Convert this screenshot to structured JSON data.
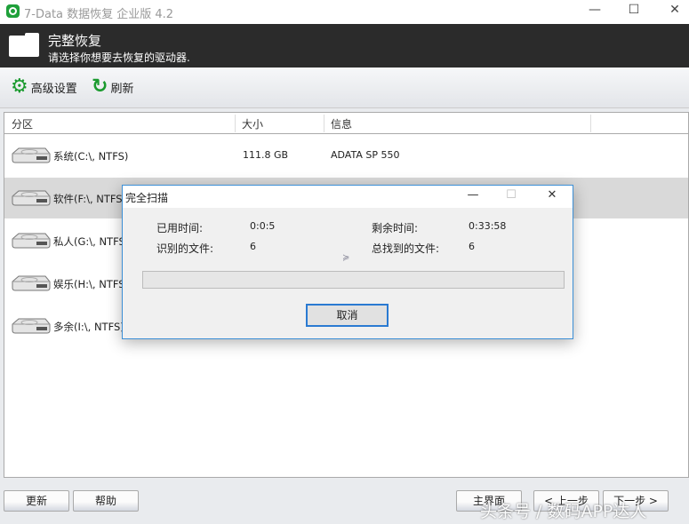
{
  "window": {
    "title": "7-Data 数据恢复 企业版 4.2",
    "minimize": "—",
    "maximize": "☐",
    "close": "✕"
  },
  "header": {
    "title": "完整恢复",
    "subtitle": "请选择你想要去恢复的驱动器."
  },
  "toolbar": {
    "advanced": "高级设置",
    "refresh": "刷新"
  },
  "table": {
    "columns": [
      "分区",
      "大小",
      "信息"
    ],
    "rows": [
      {
        "name": "系统(C:\\, NTFS)",
        "size": "111.8 GB",
        "info": "ADATA SP 550"
      },
      {
        "name": "软件(F:\\, NTFS",
        "size": "",
        "info": ""
      },
      {
        "name": "私人(G:\\, NTFS",
        "size": "",
        "info": ""
      },
      {
        "name": "娱乐(H:\\, NTFS",
        "size": "",
        "info": ""
      },
      {
        "name": "多余(I:\\, NTFS)",
        "size": "",
        "info": ""
      }
    ]
  },
  "dialog": {
    "title": "完全扫描",
    "elapsed_label": "已用时间:",
    "elapsed": "0:0:5",
    "remaining_label": "剩余时间:",
    "remaining": "0:33:58",
    "identified_label": "识别的文件:",
    "identified": "6",
    "found_label": "总找到的文件:",
    "found": "6",
    "expand": "≽",
    "progress_percent": 0,
    "cancel": "取消",
    "minimize": "—",
    "maximize": "☐",
    "close": "✕"
  },
  "footer": {
    "update": "更新",
    "help": "帮助",
    "main": "主界面",
    "back": "< 上一步",
    "next": "下一步 >"
  },
  "watermark": "头条号 / 数码APP达人"
}
